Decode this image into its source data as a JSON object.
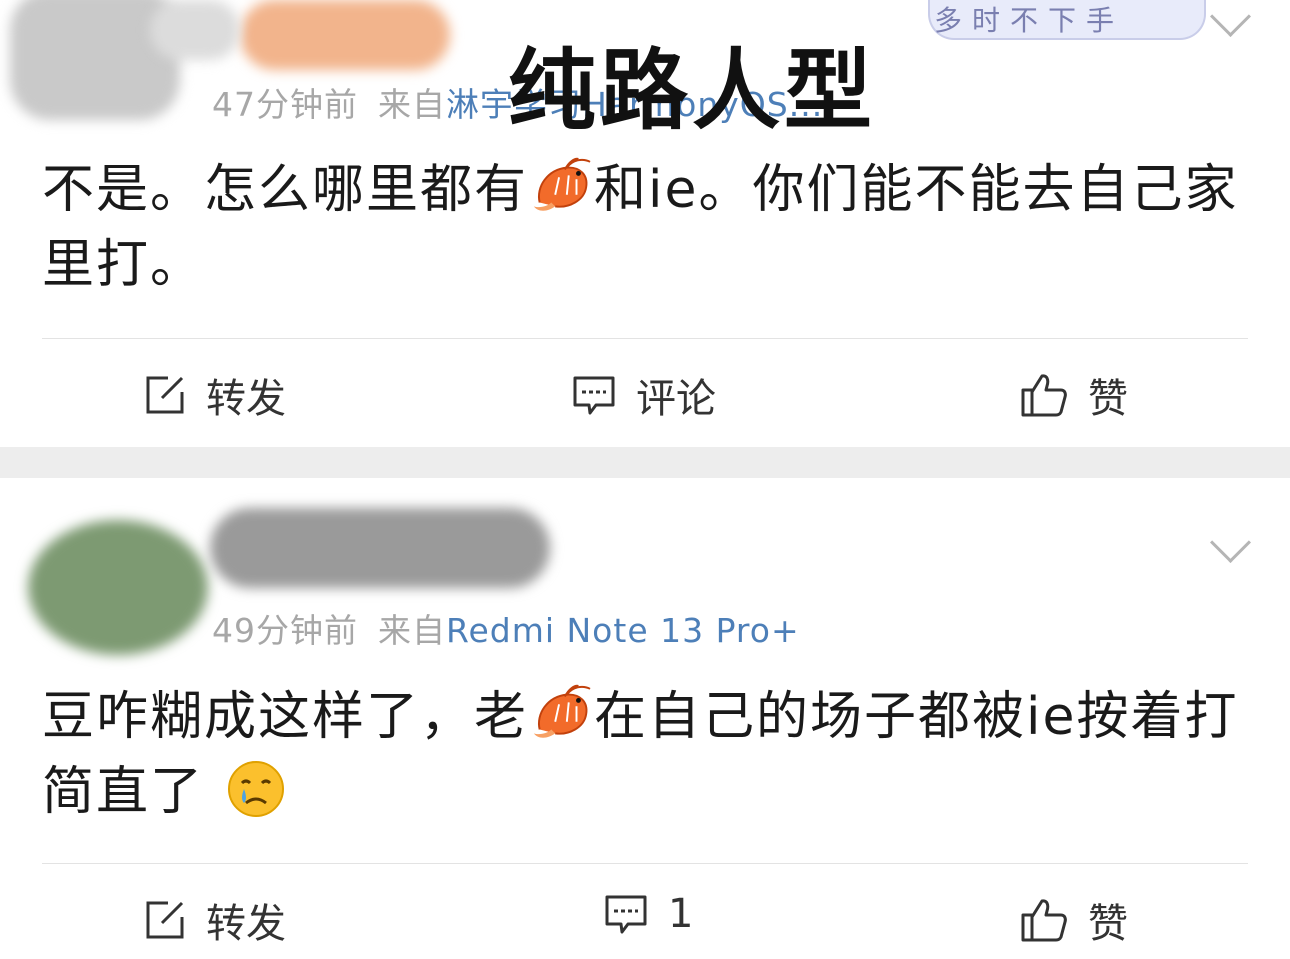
{
  "overlay_title": "纯路人型",
  "sticker_text": "多时不下手",
  "posts": [
    {
      "time": "47分钟前",
      "from_label": "来自",
      "source": "淋宇学习HarmonyOS...",
      "content_before": "不是。怎么哪里都有",
      "content_after": "和ie。你们能不能去自己家里打。",
      "actions": {
        "repost": "转发",
        "comment": "评论",
        "like": "赞"
      }
    },
    {
      "time": "49分钟前",
      "from_label": "来自",
      "source": "Redmi Note 13 Pro+",
      "content_before": "豆咋糊成这样了，老",
      "content_after": "在自己的场子都被ie按着打简直了 ",
      "actions": {
        "repost": "转发",
        "comment": "1",
        "like": "赞"
      }
    }
  ],
  "icons": {
    "shrimp": "shrimp-emoji",
    "crying": "crying-face-emoji",
    "repost": "edit-share-icon",
    "comment": "comment-bubble-icon",
    "like": "thumbs-up-icon",
    "expand": "chevron-down-icon"
  },
  "colors": {
    "source_link": "#4d7fb8",
    "meta_gray": "#a7a7a7",
    "separator": "#ededed"
  }
}
